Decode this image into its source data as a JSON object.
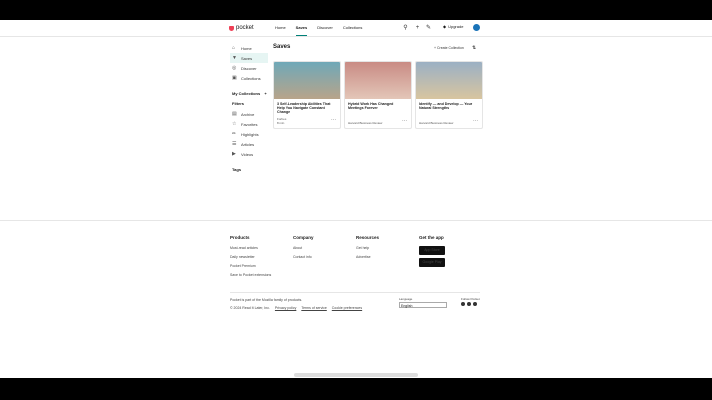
{
  "header": {
    "logo": "pocket",
    "nav": [
      "Home",
      "Saves",
      "Discover",
      "Collections"
    ],
    "upgrade_label": "Upgrade"
  },
  "sidebar": {
    "items": [
      {
        "label": "Home",
        "icon": "home-icon"
      },
      {
        "label": "Saves",
        "icon": "saves-icon"
      },
      {
        "label": "Discover",
        "icon": "discover-icon"
      },
      {
        "label": "Collections",
        "icon": "collections-icon"
      }
    ],
    "my_collections": "My Collections",
    "filters_title": "Filters",
    "filters": [
      {
        "label": "Archive",
        "icon": "archive-icon"
      },
      {
        "label": "Favorites",
        "icon": "star-icon"
      },
      {
        "label": "Highlights",
        "icon": "highlight-icon"
      },
      {
        "label": "Articles",
        "icon": "article-icon"
      },
      {
        "label": "Videos",
        "icon": "video-icon"
      }
    ],
    "tags_title": "Tags"
  },
  "main": {
    "title": "Saves",
    "create_label": "Create Collection",
    "cards": [
      {
        "title": "3 Self-Leadership Abilities That Help You Navigate Constant Change",
        "publisher": "Forbes",
        "meta": "8 min",
        "color_top": "#6fa8b8",
        "color_bot": "#b8a48a"
      },
      {
        "title": "Hybrid Work Has Changed Meetings Forever",
        "publisher": "Harvard Business Review",
        "meta": "",
        "color_top": "#c98b84",
        "color_bot": "#e3c6b8"
      },
      {
        "title": "Identify — and Develop — Your Natural Strengths",
        "publisher": "Harvard Business Review",
        "meta": "",
        "color_top": "#9bb0c4",
        "color_bot": "#d8c5a0"
      }
    ]
  },
  "footer": {
    "products": {
      "title": "Products",
      "items": [
        "Must-read articles",
        "Daily newsletter",
        "Pocket Premium",
        "Save to Pocket extensions"
      ]
    },
    "company": {
      "title": "Company",
      "items": [
        "About",
        "Contact info"
      ]
    },
    "resources": {
      "title": "Resources",
      "items": [
        "Get help",
        "Advertise"
      ]
    },
    "get_app": {
      "title": "Get the app",
      "badges": [
        "App Store",
        "Google Play"
      ]
    },
    "bottom_line1": "Pocket is part of the Mozilla family of products.",
    "bottom_line2_parts": [
      "© 2024 Read It Later, Inc.",
      "Privacy policy",
      "Terms of service",
      "Cookie preferences"
    ],
    "language_label": "Language",
    "language_value": "English",
    "social_label": "Follow Pocket"
  }
}
